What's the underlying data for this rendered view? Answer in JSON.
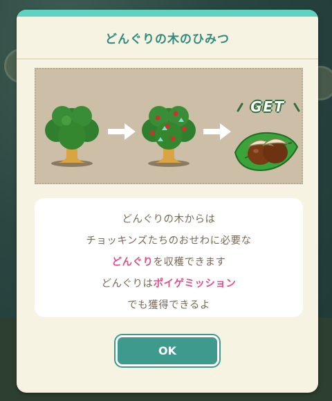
{
  "dialog": {
    "title": "どんぐりの木のひみつ",
    "illustration": {
      "get_label": "GET",
      "icons": [
        "tree-icon",
        "fruiting-tree-icon",
        "acorns-on-leaf-icon"
      ]
    },
    "message": {
      "line1": "どんぐりの木からは",
      "line2": "チョッキンズたちのおせわに必要な",
      "line3_highlight": "どんぐり",
      "line3_rest": "を収穫できます",
      "line4_prefix": "どんぐりは",
      "line4_highlight": "ポイゲミッション",
      "line5": "でも獲得できるよ"
    },
    "ok_label": "OK"
  },
  "colors": {
    "accent": "#3d9a8d",
    "title": "#2f8b7e",
    "highlight": "#e0508c",
    "text": "#7a6a55"
  }
}
